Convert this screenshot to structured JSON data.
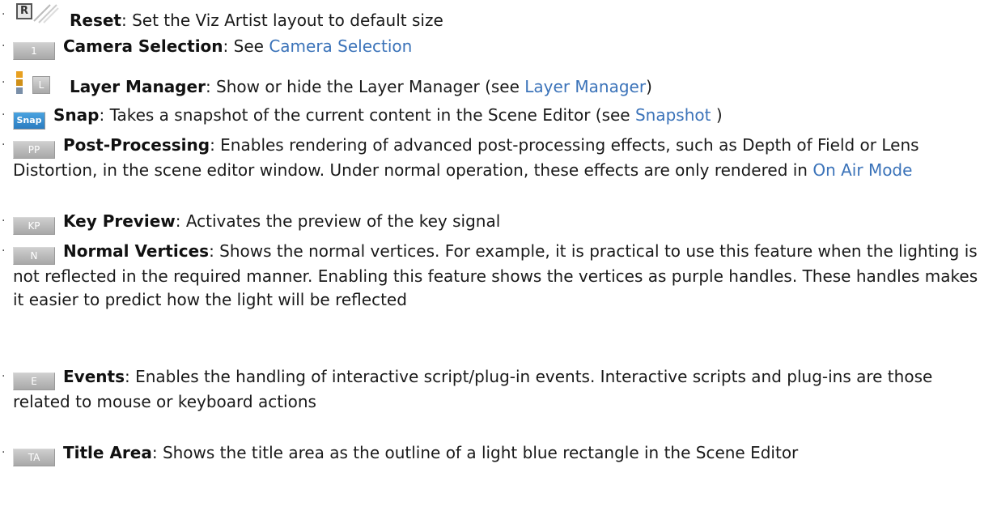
{
  "bullet": "·",
  "colors": {
    "link": "#3b73b9",
    "button_bg": "#b8b8b8",
    "snap_bg": "#3a8fd3"
  },
  "items": [
    {
      "icon": "reset-icon",
      "icon_text": "R",
      "term": "Reset",
      "text": ": Set the Viz Artist layout to default size"
    },
    {
      "icon": "camera-1-button-icon",
      "icon_text": "1",
      "term": "Camera Selection",
      "text": ": See ",
      "link": "Camera Selection"
    },
    {
      "icon": "layer-manager-icon",
      "icon_text": "L",
      "term": "Layer Manager",
      "text": ": Show or hide the Layer Manager (see ",
      "link": "Layer Manager",
      "after": ")"
    },
    {
      "icon": "snap-button-icon",
      "icon_text": "Snap",
      "term": "Snap",
      "text": ": Takes a snapshot of the current content in the Scene Editor (see ",
      "link": "Snapshot",
      "after": " )"
    },
    {
      "icon": "post-processing-button-icon",
      "icon_text": "PP",
      "term": "Post-Processing",
      "text": ": Enables rendering of advanced post-processing effects, such as Depth of Field or Lens Distortion, in the scene editor window. Under normal operation, these effects are only rendered in ",
      "link": "On Air Mode"
    },
    {
      "icon": "key-preview-button-icon",
      "icon_text": "KP",
      "term": "Key Preview",
      "text": ": Activates the preview of the key signal"
    },
    {
      "icon": "normal-vertices-button-icon",
      "icon_text": "N",
      "term": "Normal Vertices",
      "text": ": Shows the normal vertices. For example, it is practical to use this feature when the lighting is not reflected in the required manner. Enabling this feature shows the vertices as purple handles. These handles makes it easier to predict how the light will be reflected"
    },
    {
      "icon": "events-button-icon",
      "icon_text": "E",
      "term": "Events",
      "text": ": Enables the handling of interactive script/plug-in events. Interactive scripts and plug-ins are those related to mouse or keyboard actions"
    },
    {
      "icon": "title-area-button-icon",
      "icon_text": "TA",
      "term": "Title Area",
      "text": ": Shows the title area as the outline of a light blue rectangle in the Scene Editor"
    }
  ]
}
